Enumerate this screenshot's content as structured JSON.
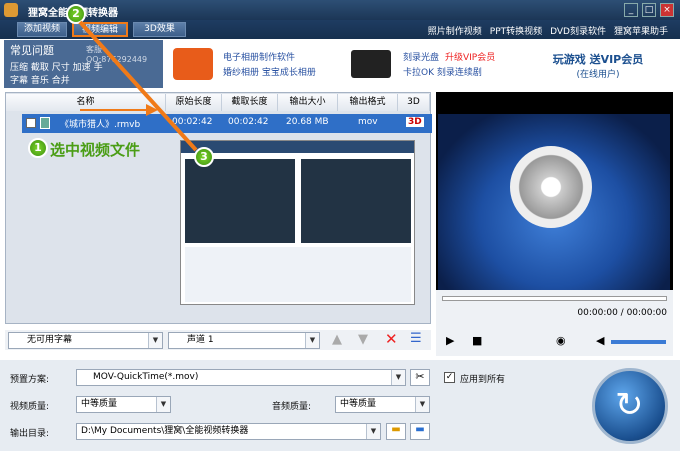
{
  "window": {
    "title": "狸窝全能视频转换器",
    "min": "_",
    "max": "□",
    "close": "×"
  },
  "toolbar": {
    "add_video": "添加视频",
    "video_edit": "视频编辑",
    "effect_3d": "3D效果",
    "links": [
      "照片制作视频",
      "PPT转换视频",
      "DVD刻录软件",
      "狸窝苹果助手"
    ]
  },
  "ads": {
    "faq": "常见问题",
    "qq": "客服QQ:876292449",
    "row1": [
      "压缩",
      "截取",
      "尺寸",
      "加速",
      "手"
    ],
    "row2": [
      "字幕",
      "音乐",
      "合并"
    ],
    "mid1a": "电子相册制作软件",
    "mid1b": "婚纱相册 宝宝成长相册",
    "mid2a": "刻录光盘",
    "mid2b": "升级VIP会员",
    "mid2c": "卡拉OK 刻录连续剧",
    "right1": "玩游戏 送VIP会员",
    "right2": "(在线用户)"
  },
  "table": {
    "headers": [
      "名称",
      "原始长度",
      "截取长度",
      "输出大小",
      "输出格式",
      "3D"
    ],
    "row": {
      "name": "《城市猎人》.rmvb",
      "orig": "00:02:42",
      "cut": "00:02:42",
      "size": "20.68 MB",
      "format": "mov",
      "badge": "3D"
    }
  },
  "annotation": {
    "n1": "1",
    "n2": "2",
    "n3": "3",
    "label1": "选中视频文件"
  },
  "under_list": {
    "subtitle": "无可用字幕",
    "audio": "声道 1"
  },
  "player": {
    "time": "00:00:00 / 00:00:00"
  },
  "settings": {
    "preset_label": "预置方案:",
    "preset_value": "MOV-QuickTime(*.mov)",
    "apply_all": "应用到所有",
    "video_q_label": "视频质量:",
    "video_q_value": "中等质量",
    "audio_q_label": "音频质量:",
    "audio_q_value": "中等质量",
    "output_label": "输出目录:",
    "output_value": "D:\\My Documents\\狸窝\\全能视频转换器"
  }
}
